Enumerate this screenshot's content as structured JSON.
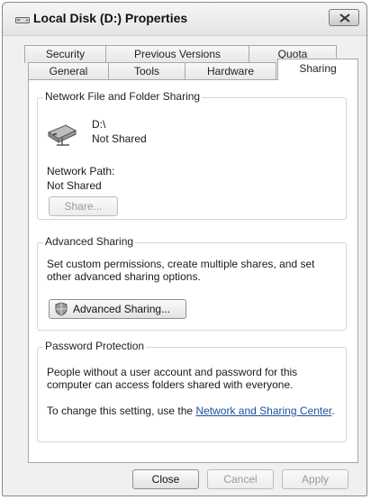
{
  "window": {
    "title": "Local Disk (D:) Properties"
  },
  "tabs": {
    "row_back": [
      "Security",
      "Previous Versions",
      "Quota"
    ],
    "row_front": [
      "General",
      "Tools",
      "Hardware",
      "Sharing"
    ],
    "active": "Sharing"
  },
  "network_sharing": {
    "group_title": "Network File and Folder Sharing",
    "drive": "D:\\",
    "status": "Not Shared",
    "path_label": "Network Path:",
    "path_value": "Not Shared",
    "share_button": "Share..."
  },
  "advanced_sharing": {
    "group_title": "Advanced Sharing",
    "description": "Set custom permissions, create multiple shares, and set other advanced sharing options.",
    "button": "Advanced Sharing..."
  },
  "password_protection": {
    "group_title": "Password Protection",
    "description": "People without a user account and password for this computer can access folders shared with everyone.",
    "change_prefix": "To change this setting, use the ",
    "link_text": "Network and Sharing Center",
    "change_suffix": "."
  },
  "footer": {
    "close": "Close",
    "cancel": "Cancel",
    "apply": "Apply"
  },
  "icons": {
    "title": "drive-icon",
    "drive": "network-drive-icon",
    "shield": "shield-icon",
    "close": "close-icon"
  }
}
